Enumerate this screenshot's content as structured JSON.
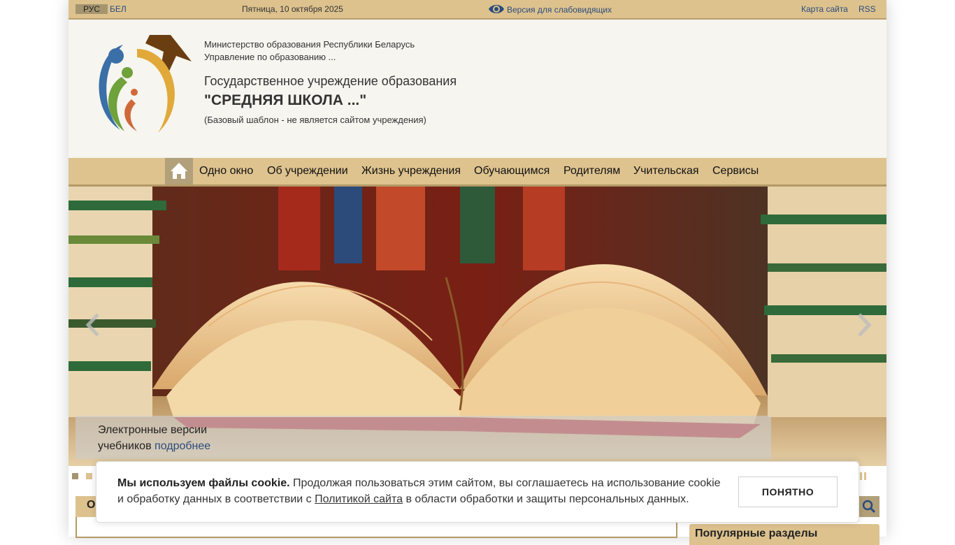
{
  "topbar": {
    "lang_ru": "РУС",
    "lang_by": "БЕЛ",
    "date": "Пятница, 10 октября 2025",
    "vision_version": "Версия для слабовидящих",
    "sitemap": "Карта сайта",
    "rss": "RSS"
  },
  "header": {
    "ministry": "Министерство образования Республики Беларусь",
    "department": "Управление по образованию ...",
    "institution_type": "Государственное учреждение образования",
    "institution_name": "\"СРЕДНЯЯ ШКОЛА ...\"",
    "note": "(Базовый шаблон - не является сайтом учреждения)"
  },
  "nav": {
    "items": [
      "Одно окно",
      "Об учреждении",
      "Жизнь учреждения",
      "Обучающимся",
      "Родителям",
      "Учительская",
      "Сервисы"
    ]
  },
  "slider": {
    "caption_line1": "Электронные версии",
    "caption_line2": "учебников",
    "caption_link": "подробнее",
    "slide_count": 2,
    "active_slide": 1
  },
  "content": {
    "left_block_letter": "О",
    "popular_title": "Популярные разделы"
  },
  "cookie": {
    "bold": "Мы используем файлы cookie.",
    "text1": " Продолжая пользоваться этим сайтом, вы соглашаетесь на использование cookie и обработку данных в соответствии с ",
    "link": "Политикой сайта",
    "text2": " в области обработки и защиты персональных данных.",
    "button": "ПОНЯТНО"
  },
  "colors": {
    "accent": "#ddc28e",
    "nav_border": "#b39a66",
    "link": "#2b4c7b"
  }
}
